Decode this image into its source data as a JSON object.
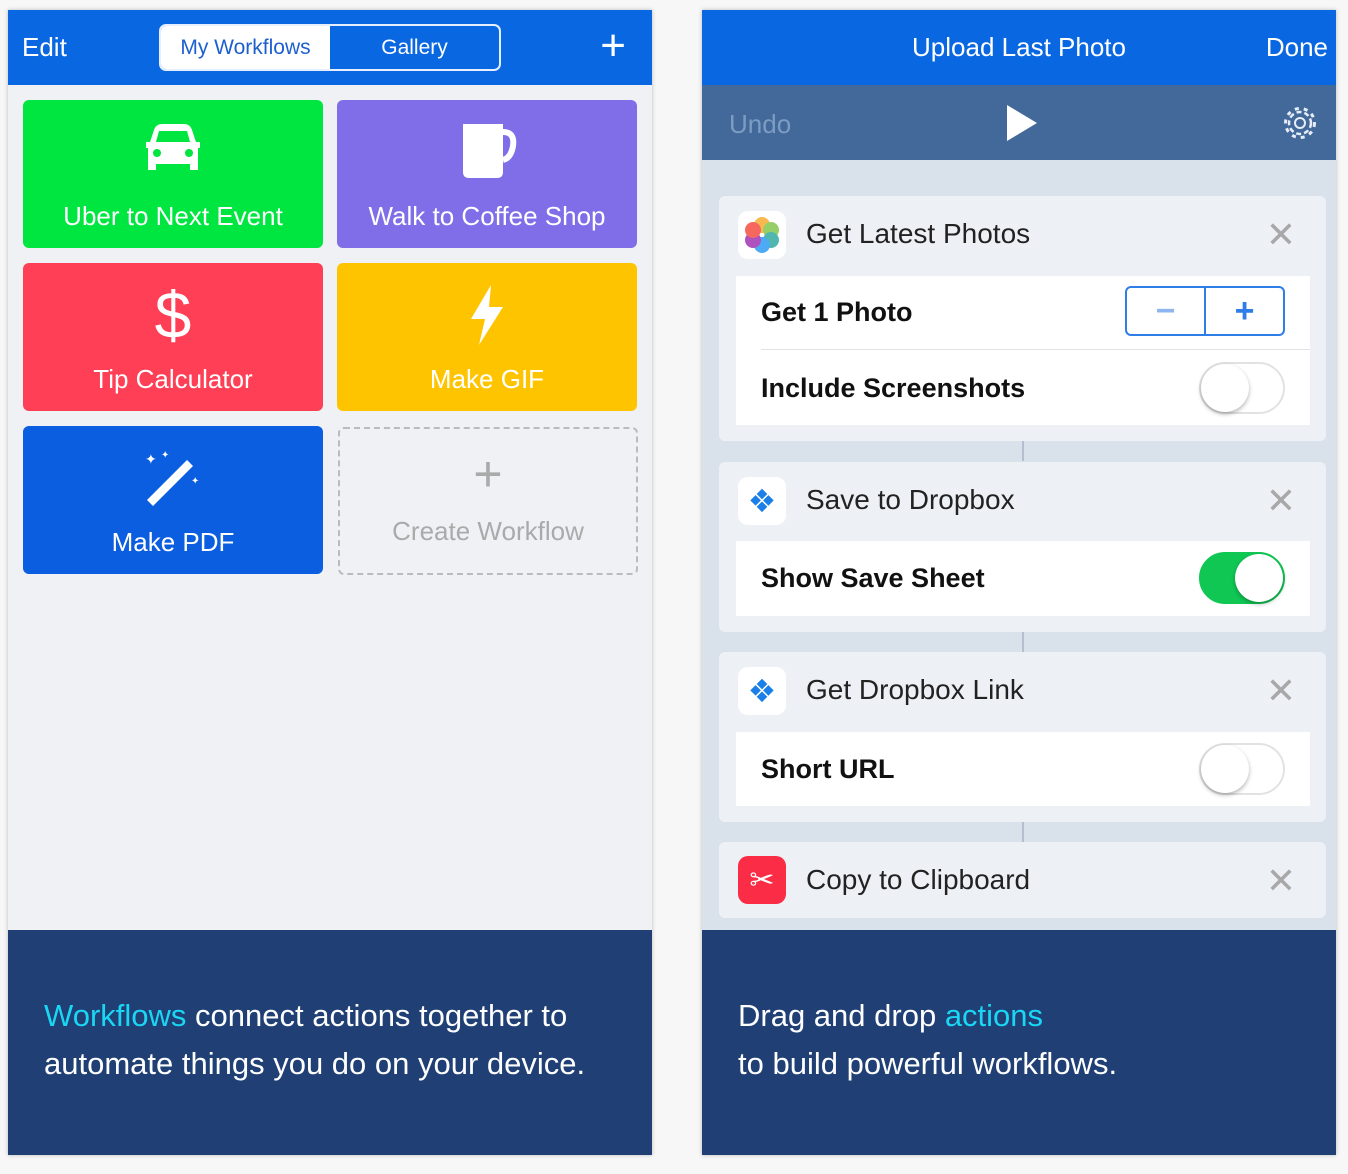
{
  "left": {
    "nav": {
      "edit": "Edit",
      "tabs": [
        "My Workflows",
        "Gallery"
      ],
      "active_tab": "My Workflows",
      "add": "+"
    },
    "tiles": [
      {
        "label": "Uber to Next Event",
        "icon": "car-icon",
        "color": "#00e640"
      },
      {
        "label": "Walk to Coffee Shop",
        "icon": "mug-icon",
        "color": "#7f6ee8"
      },
      {
        "label": "Tip Calculator",
        "icon": "dollar-icon",
        "color": "#fe3f55"
      },
      {
        "label": "Make GIF",
        "icon": "lightning-icon",
        "color": "#ffc400"
      },
      {
        "label": "Make PDF",
        "icon": "magic-wand-icon",
        "color": "#0b5edf"
      }
    ],
    "create": {
      "label": "Create Workflow",
      "icon": "+"
    },
    "caption": {
      "highlight": "Workflows",
      "line1": " connect actions together to",
      "line2": "automate things you do on your device."
    }
  },
  "right": {
    "nav": {
      "title": "Upload Last Photo",
      "done": "Done"
    },
    "toolbar": {
      "undo": "Undo",
      "run": "play-icon",
      "settings": "gear-icon"
    },
    "actions": [
      {
        "title": "Get Latest Photos",
        "icon": "photos-icon",
        "stepper_label": "Get 1 Photo",
        "stepper_minus": "−",
        "stepper_plus": "+",
        "toggle_label": "Include Screenshots",
        "toggle_on": false
      },
      {
        "title": "Save to Dropbox",
        "icon": "dropbox-icon",
        "toggle_label": "Show Save Sheet",
        "toggle_on": true
      },
      {
        "title": "Get Dropbox Link",
        "icon": "dropbox-icon",
        "toggle_label": "Short URL",
        "toggle_on": false
      },
      {
        "title": "Copy to Clipboard",
        "icon": "scissors-icon"
      }
    ],
    "caption": {
      "line1_pre": "Drag and drop ",
      "highlight": "actions",
      "line2": "to build powerful workflows."
    }
  },
  "colors": {
    "nav_blue": "#0a67e2",
    "caption_bg": "#1f3f75",
    "highlight": "#1ad6f3",
    "toggle_on": "#10c754"
  }
}
